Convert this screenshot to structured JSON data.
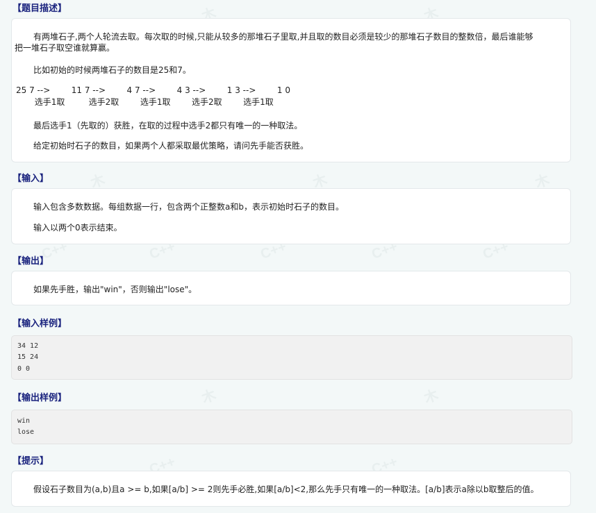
{
  "watermark": {
    "text": "C++",
    "glyph": "木"
  },
  "sections": {
    "description": {
      "title": "【题目描述】",
      "p1_a": "有两堆石子,两个人轮流去取。每次取的时候,只能从较多的那堆石子里取,并且取的数目必须是较少的那堆石子数目的整数倍，最后谁能够",
      "p1_b": "把一堆石子取空谁就算赢。",
      "p2": "比如初始的时候两堆石子的数目是25和7。",
      "steps_line1": "25 7 -->        11 7 -->        4 7 -->        4 3 -->        1 3 -->        1 0",
      "steps_line2": "       选手1取         选手2取        选手1取        选手2取        选手1取",
      "p3": "最后选手1（先取的）获胜，在取的过程中选手2都只有唯一的一种取法。",
      "p4": "给定初始时石子的数目，如果两个人都采取最优策略，请问先手能否获胜。"
    },
    "input": {
      "title": "【输入】",
      "p1": "输入包含多数数据。每组数据一行，包含两个正整数a和b，表示初始时石子的数目。",
      "p2": "输入以两个0表示结束。"
    },
    "output": {
      "title": "【输出】",
      "p1": "如果先手胜，输出\"win\"，否则输出\"lose\"。"
    },
    "sample_input": {
      "title": "【输入样例】",
      "lines": [
        "34 12",
        "15 24",
        "0 0"
      ]
    },
    "sample_output": {
      "title": "【输出样例】",
      "lines": [
        "win",
        "lose"
      ]
    },
    "hint": {
      "title": "【提示】",
      "p1": "假设石子数目为(a,b)且a >= b,如果[a/b] >= 2则先手必胜,如果[a/b]<2,那么先手只有唯一的一种取法。[a/b]表示a除以b取整后的值。"
    }
  }
}
